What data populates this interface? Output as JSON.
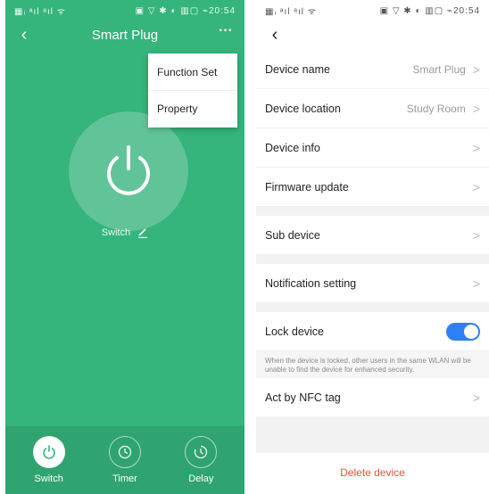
{
  "left_screen": {
    "status": {
      "left": "▦ᵢ ᵃıl ᵃıl ᯤ",
      "right": "▣ ▽ ✱ ◐ ▥▢ ⌁20:54"
    },
    "title": "Smart Plug",
    "more_symbol": "···",
    "back_symbol": "‹",
    "menu": [
      {
        "label": "Function Set"
      },
      {
        "label": "Property"
      }
    ],
    "switch_label": "Switch",
    "bottom_tabs": [
      {
        "label": "Switch",
        "icon": "power-icon",
        "active": true
      },
      {
        "label": "Timer",
        "icon": "clock-icon",
        "active": false
      },
      {
        "label": "Delay",
        "icon": "delay-clock-icon",
        "active": false
      }
    ],
    "colors": {
      "background": "#35b47c",
      "bottom_bar": "#2fa470"
    }
  },
  "right_screen": {
    "status": {
      "left": "▦ᵢ ᵃıl ᵃıl ᯤ",
      "right": "▣ ▽ ✱ ◐ ▥▢ ⌁20:54"
    },
    "back_symbol": "‹",
    "rows": {
      "device_name": {
        "label": "Device name",
        "value": "Smart Plug"
      },
      "device_location": {
        "label": "Device location",
        "value": "Study Room"
      },
      "device_info": {
        "label": "Device info"
      },
      "firmware_update": {
        "label": "Firmware update"
      },
      "sub_device": {
        "label": "Sub device"
      },
      "notification_setting": {
        "label": "Notification setting"
      },
      "lock_device": {
        "label": "Lock device",
        "enabled": true
      },
      "lock_note": "When the device is locked, other users in the same WLAN will be unable to find the device for enhanced security.",
      "act_by_nfc": {
        "label": "Act by NFC tag"
      }
    },
    "chevron": ">",
    "delete_label": "Delete device",
    "colors": {
      "toggle_on": "#2f80f7",
      "delete": "#e0533a"
    }
  }
}
